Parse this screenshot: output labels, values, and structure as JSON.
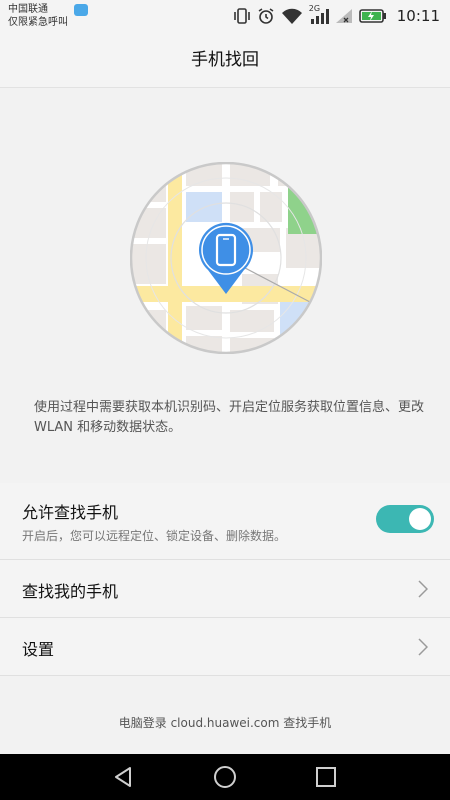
{
  "status_bar": {
    "carrier_line1": "中国联通",
    "carrier_line2": "仅限紧急呼叫",
    "network": "2G",
    "time": "10:11",
    "icons": [
      "app-notification-icon",
      "vibrate-icon",
      "alarm-icon",
      "wifi-icon",
      "signal-icon",
      "no-sim-icon",
      "battery-charging-icon"
    ]
  },
  "header": {
    "title": "手机找回"
  },
  "illustration": {
    "icon": "phone-location-pin-icon",
    "colors": {
      "pin": "#3f8fe6",
      "road": "#fce9a0",
      "park": "#8fd28b",
      "water": "#cfe0f7",
      "block": "#e9e6e3"
    }
  },
  "description": "使用过程中需要获取本机识别码、开启定位服务获取位置信息、更改 WLAN 和移动数据状态。",
  "settings": {
    "allow_find": {
      "label": "允许查找手机",
      "subtitle": "开启后，您可以远程定位、锁定设备、删除数据。",
      "enabled": true,
      "accent": "#3cb7b3"
    },
    "find_my_phone": {
      "label": "查找我的手机"
    },
    "settings_item": {
      "label": "设置"
    }
  },
  "footer": {
    "text": "电脑登录 cloud.huawei.com 查找手机"
  },
  "nav_bar": {
    "icons": [
      "back-icon",
      "home-icon",
      "recents-icon"
    ]
  }
}
